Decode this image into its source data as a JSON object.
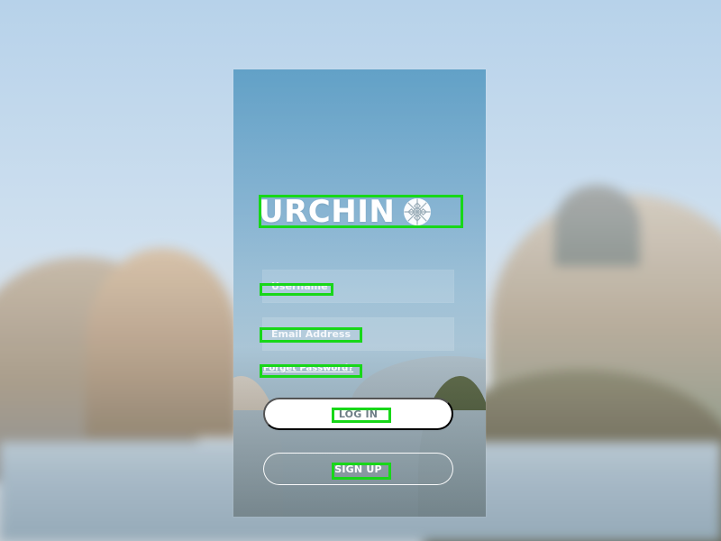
{
  "app": {
    "logo": "URCHIN",
    "logo_icon": "urchin-icon",
    "username_placeholder": "Username",
    "email_placeholder": "Email Address",
    "forgot_password": "Forget Password?",
    "login_button": "LOG IN",
    "signup_button": "SIGN UP"
  },
  "colors": {
    "highlight": "#18d719",
    "button_text": "#707f88",
    "button_fill": "#ffffff",
    "text": "#ffffff"
  }
}
